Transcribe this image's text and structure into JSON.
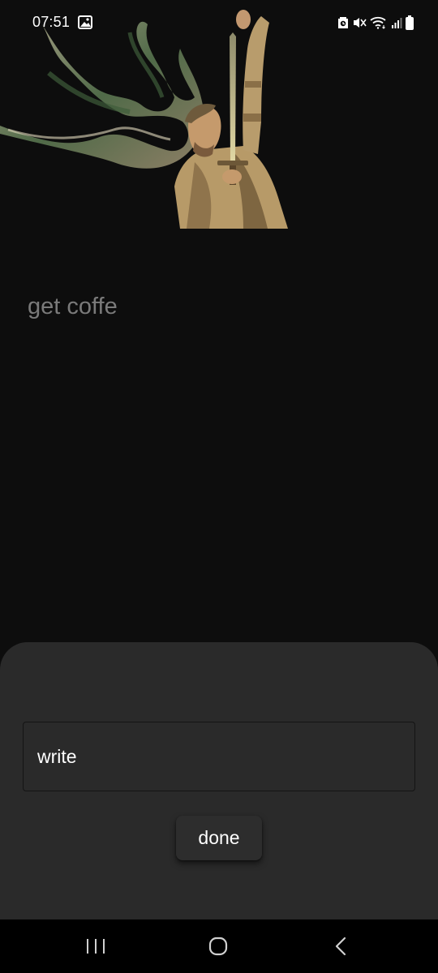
{
  "status_bar": {
    "time": "07:51",
    "icons": [
      "gallery-icon",
      "battery-saver-icon",
      "mute-icon",
      "wifi-icon",
      "signal-icon",
      "battery-icon"
    ]
  },
  "hero": {
    "icon": "knight-raising-sword-illustration"
  },
  "task": {
    "text": "get coffe"
  },
  "sheet": {
    "input_value": "write",
    "done_label": "done"
  },
  "nav_bar": {
    "icons": [
      "recents-icon",
      "home-icon",
      "back-icon"
    ]
  },
  "colors": {
    "background": "#0d0d0d",
    "sheet": "#2a2a2a",
    "task_text": "#7a7a7a",
    "nav_bar": "#000000"
  }
}
